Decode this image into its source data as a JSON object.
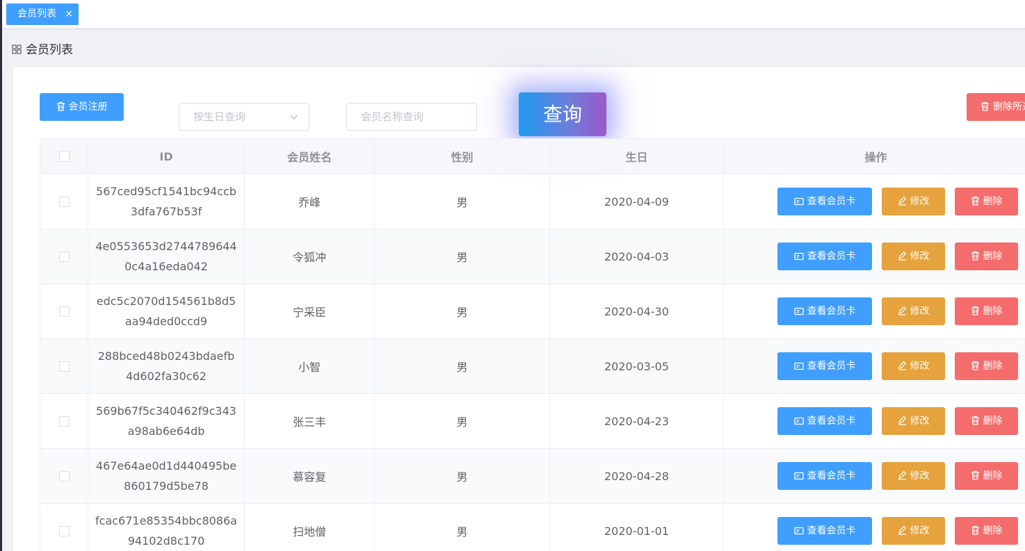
{
  "tabs": [
    {
      "label": "会员列表",
      "close": "×"
    }
  ],
  "page": {
    "title": "会员列表"
  },
  "toolbar": {
    "register_label": "会员注册",
    "birthday_placeholder": "按生日查询",
    "name_placeholder": "会员名称查询",
    "query_label": "查询",
    "delete_all_label": "删除所选"
  },
  "table": {
    "columns": [
      "ID",
      "会员姓名",
      "性别",
      "生日",
      "操作"
    ],
    "action_labels": {
      "view_card": "查看会员卡",
      "edit": "修改",
      "delete": "删除"
    },
    "rows": [
      {
        "id": "567ced95cf1541bc94ccb3dfa767b53f",
        "name": "乔峰",
        "gender": "男",
        "birthday": "2020-04-09"
      },
      {
        "id": "4e0553653d27447896440c4a16eda042",
        "name": "令狐冲",
        "gender": "男",
        "birthday": "2020-04-03"
      },
      {
        "id": "edc5c2070d154561b8d5aa94ded0ccd9",
        "name": "宁采臣",
        "gender": "男",
        "birthday": "2020-04-30"
      },
      {
        "id": "288bced48b0243bdaefb4d602fa30c62",
        "name": "小智",
        "gender": "男",
        "birthday": "2020-03-05"
      },
      {
        "id": "569b67f5c340462f9c343a98ab6e64db",
        "name": "张三丰",
        "gender": "男",
        "birthday": "2020-04-23"
      },
      {
        "id": "467e64ae0d1d440495be860179d5be78",
        "name": "慕容复",
        "gender": "男",
        "birthday": "2020-04-28"
      },
      {
        "id": "fcac671e85354bbc8086a94102d8c170",
        "name": "扫地僧",
        "gender": "男",
        "birthday": "2020-01-01"
      }
    ]
  },
  "colors": {
    "primary": "#409eff",
    "warning": "#e6a23c",
    "danger": "#f56c6c"
  }
}
